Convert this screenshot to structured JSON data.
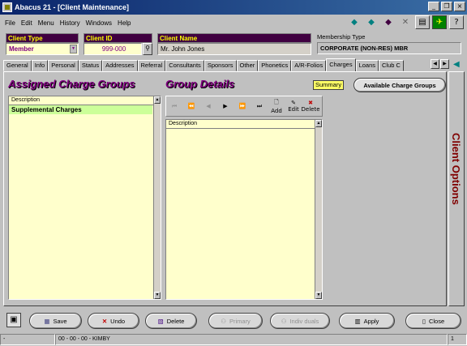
{
  "window": {
    "title": "Abacus 21 - [Client Maintenance]"
  },
  "menu": [
    "File",
    "Edit",
    "Menu",
    "History",
    "Windows",
    "Help"
  ],
  "toolbar_icons": [
    "arrow-left-icon",
    "arrow-right-icon",
    "diamond-icon",
    "x-icon",
    "calculator-icon",
    "running-man-icon",
    "help-icon"
  ],
  "client": {
    "type_label": "Client Type",
    "type_value": "Member",
    "id_label": "Client ID",
    "id_value": "999-000",
    "name_label": "Client Name",
    "name_value": "Mr. John  Jones",
    "membership_label": "Membership Type",
    "membership_value": "CORPORATE (NON-RES) MBR"
  },
  "tabs": [
    "General",
    "Info",
    "Personal",
    "Status",
    "Addresses",
    "Referral",
    "Consultants",
    "Sponsors",
    "Other",
    "Phonetics",
    "A/R-Folios",
    "Charges",
    "Loans",
    "Club C"
  ],
  "active_tab": "Charges",
  "assigned": {
    "heading": "Assigned Charge Groups",
    "col": "Description",
    "rows": [
      "Supplemental Charges"
    ]
  },
  "details": {
    "heading": "Group Details",
    "summary": "Summary",
    "available_button": "Available Charge Groups",
    "col": "Description",
    "nav": {
      "add": "Add",
      "edit": "Edit",
      "delete": "Delete"
    }
  },
  "side_panel": "Client Options",
  "buttons": {
    "save": "Save",
    "undo": "Undo",
    "delete": "Delete",
    "primary": "Primary",
    "individuals": "Indiv duals",
    "apply": "Apply",
    "close": "Close"
  },
  "status": {
    "left": "-",
    "time_user": "00 - 00 - 00 - KIMBY",
    "page": "1"
  },
  "colors": {
    "label_bg": "#400040",
    "label_fg": "#ffff00",
    "heading": "#800080",
    "panel_bg": "#ffffcc",
    "side_text": "#800000"
  }
}
